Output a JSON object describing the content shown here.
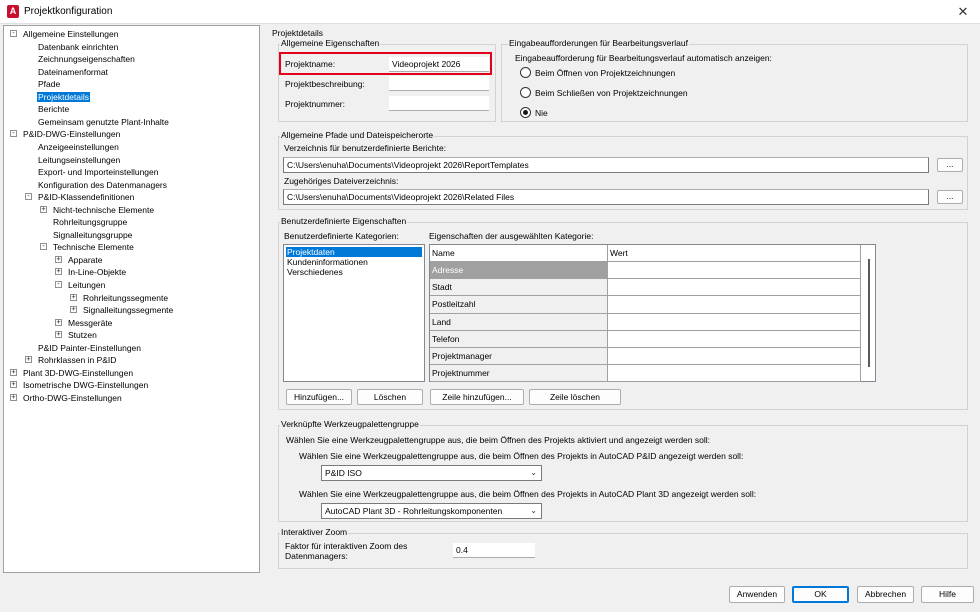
{
  "window": {
    "title": "Projektkonfiguration",
    "app_letter": "A",
    "close_glyph": "✕"
  },
  "tree": [
    {
      "label": "Allgemeine Einstellungen",
      "level": 0,
      "exp": "-"
    },
    {
      "label": "Datenbank einrichten",
      "level": 1
    },
    {
      "label": "Zeichnungseigenschaften",
      "level": 1
    },
    {
      "label": "Dateinamenformat",
      "level": 1
    },
    {
      "label": "Pfade",
      "level": 1
    },
    {
      "label": "Projektdetails",
      "level": 1,
      "selected": true
    },
    {
      "label": "Berichte",
      "level": 1
    },
    {
      "label": "Gemeinsam genutzte Plant-Inhalte",
      "level": 1
    },
    {
      "label": "P&ID-DWG-Einstellungen",
      "level": 0,
      "exp": "-"
    },
    {
      "label": "Anzeigeeinstellungen",
      "level": 1
    },
    {
      "label": "Leitungseinstellungen",
      "level": 1
    },
    {
      "label": "Export- und Importeinstellungen",
      "level": 1
    },
    {
      "label": "Konfiguration des Datenmanagers",
      "level": 1
    },
    {
      "label": "P&ID-Klassendefinitionen",
      "level": 1,
      "exp": "-"
    },
    {
      "label": "Nicht-technische Elemente",
      "level": 2,
      "exp": "+"
    },
    {
      "label": "Rohrleitungsgruppe",
      "level": 2
    },
    {
      "label": "Signalleitungsgruppe",
      "level": 2
    },
    {
      "label": "Technische Elemente",
      "level": 2,
      "exp": "-"
    },
    {
      "label": "Apparate",
      "level": 3,
      "exp": "+"
    },
    {
      "label": "In-Line-Objekte",
      "level": 3,
      "exp": "+"
    },
    {
      "label": "Leitungen",
      "level": 3,
      "exp": "-"
    },
    {
      "label": "Rohrleitungssegmente",
      "level": 4,
      "exp": "+"
    },
    {
      "label": "Signalleitungssegmente",
      "level": 4,
      "exp": "+"
    },
    {
      "label": "Messgeräte",
      "level": 3,
      "exp": "+"
    },
    {
      "label": "Stutzen",
      "level": 3,
      "exp": "+"
    },
    {
      "label": "P&ID Painter-Einstellungen",
      "level": 1
    },
    {
      "label": "Rohrklassen in P&ID",
      "level": 1,
      "exp": "+"
    },
    {
      "label": "Plant 3D-DWG-Einstellungen",
      "level": 0,
      "exp": "+"
    },
    {
      "label": "Isometrische DWG-Einstellungen",
      "level": 0,
      "exp": "+"
    },
    {
      "label": "Ortho-DWG-Einstellungen",
      "level": 0,
      "exp": "+"
    }
  ],
  "details": {
    "section_title": "Projektdetails",
    "general": {
      "group_label": "Allgemeine Eigenschaften",
      "name_label": "Projektname:",
      "name_value": "Videoprojekt 2026",
      "desc_label": "Projektbeschreibung:",
      "desc_value": "",
      "number_label": "Projektnummer:",
      "number_value": ""
    },
    "input_history": {
      "group_label": "Eingabeaufforderungen für Bearbeitungsverlauf",
      "prompt": "Eingabeaufforderung für Bearbeitungsverlauf automatisch anzeigen:",
      "options": [
        {
          "label": "Beim Öffnen von Projektzeichnungen",
          "checked": false
        },
        {
          "label": "Beim Schließen von Projektzeichnungen",
          "checked": false
        },
        {
          "label": "Nie",
          "checked": true
        }
      ]
    },
    "paths": {
      "group_label": "Allgemeine Pfade und Dateispeicherorte",
      "reports_label": "Verzeichnis für benutzerdefinierte Berichte:",
      "reports_value": "C:\\Users\\enuha\\Documents\\Videoprojekt 2026\\ReportTemplates",
      "related_label": "Zugehöriges Dateiverzeichnis:",
      "related_value": "C:\\Users\\enuha\\Documents\\Videoprojekt 2026\\Related Files",
      "browse_label": "..."
    },
    "custom": {
      "group_label": "Benutzerdefinierte Eigenschaften",
      "categories_label": "Benutzerdefinierte Kategorien:",
      "categories": [
        "Projektdaten",
        "Kundeninformationen",
        "Verschiedenes"
      ],
      "props_label": "Eigenschaften der ausgewählten Kategorie:",
      "col_name": "Name",
      "col_value": "Wert",
      "rows": [
        "Adresse",
        "Stadt",
        "Postleitzahl",
        "Land",
        "Telefon",
        "Projektmanager",
        "Projektnummer"
      ],
      "add_label": "Hinzufügen...",
      "delete_label": "Löschen",
      "add_row_label": "Zeile hinzufügen...",
      "delete_row_label": "Zeile löschen"
    },
    "palette": {
      "group_label": "Verknüpfte Werkzeugpalettengruppe",
      "prompt": "Wählen Sie eine Werkzeugpalettengruppe aus, die beim Öffnen des Projekts aktiviert und angezeigt werden soll:",
      "pid_prompt": "Wählen Sie eine Werkzeugpalettengruppe aus, die beim Öffnen des Projekts in AutoCAD P&ID angezeigt werden soll:",
      "pid_value": "P&ID ISO",
      "plant_prompt": "Wählen Sie eine Werkzeugpalettengruppe aus, die beim Öffnen des Projekts in AutoCAD Plant 3D angezeigt werden soll:",
      "plant_value": "AutoCAD Plant 3D - Rohrleitungskomponenten"
    },
    "zoom": {
      "group_label": "Interaktiver Zoom",
      "factor_label_1": "Faktor für interaktiven Zoom des",
      "factor_label_2": "Datenmanagers:",
      "factor_value": "0.4"
    }
  },
  "footer": {
    "apply": "Anwenden",
    "ok": "OK",
    "cancel": "Abbrechen",
    "help": "Hilfe"
  }
}
